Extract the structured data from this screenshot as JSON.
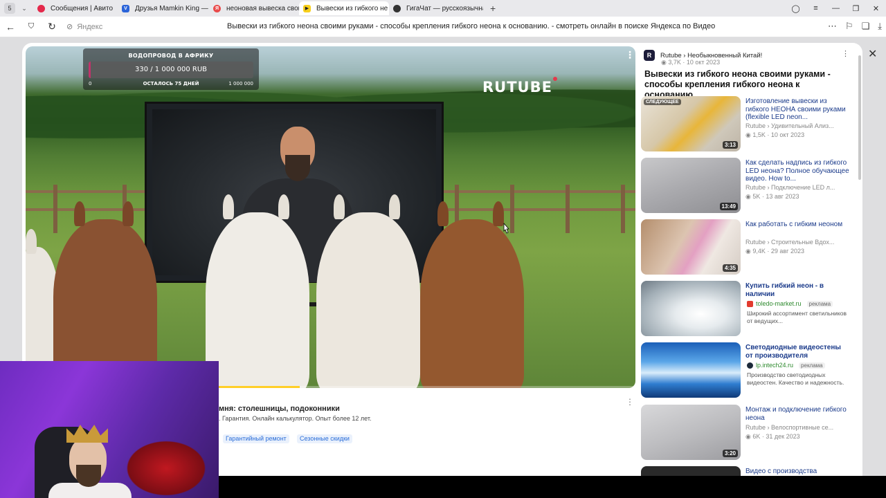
{
  "browser": {
    "tab_count": "5",
    "tabs": [
      {
        "label": "Сообщения | Авито",
        "color": "#e4294b",
        "glyph": "●"
      },
      {
        "label": "Друзья Mamkin King — 64",
        "color": "#2b64d9",
        "glyph": "V"
      },
      {
        "label": "неоновая вывеска свои",
        "color": "#e94b4b",
        "glyph": "Я"
      },
      {
        "label": "Вывески из гибкого не",
        "color": "#f7cf1b",
        "glyph": "▶"
      },
      {
        "label": "ГигаЧат — русскоязычна",
        "color": "#333333",
        "glyph": "◉"
      }
    ],
    "address_site": "Яндекс",
    "page_title": "Вывески из гибкого неона своими руками - способы крепления гибкого неона к основанию. - смотреть онлайн в поиске Яндекса по Видео"
  },
  "player": {
    "donation_title": "ВОДОПРОВОД В АФРИКУ",
    "donation_amount": "330 / 1 000 000 RUB",
    "donation_min": "0",
    "donation_left": "ОСТАЛОСЬ 75 ДНЕЙ",
    "donation_max": "1 000 000",
    "donation_progress": 0.00033,
    "brand": "RUTUBE",
    "playback_progress": 0.45
  },
  "ad": {
    "title": "мня: столешницы, подоконники",
    "desc": ". Гарантия. Онлайн калькулятор. Опыт более 12 лет.",
    "chips": [
      "Гарантийный ремонт",
      "Сезонные скидки"
    ]
  },
  "sidebar": {
    "channel": "Rutube › Необыкновенный Китай!",
    "meta": "3,7K · 10 окт 2023",
    "title": "Вывески из гибкого неона своими руками - способы крепления гибкого неона к основанию.",
    "items": [
      {
        "title": "Изготовление вывески из гибкого НЕОНА своими руками (flexible LED neon...",
        "channel": "Rutube › Удивительный Ализ...",
        "meta": "1,5K · 10 окт 2023",
        "duration": "3:13",
        "badge": "СЛЕДУЮЩЕЕ"
      },
      {
        "title": "Как сделать надпись из гибкого LED неона? Полное обучающее видео. How to...",
        "channel": "Rutube › Подключение LED л...",
        "meta": "5K · 13 авг 2023",
        "duration": "13:49"
      },
      {
        "title": "Как работать с гибким неоном",
        "channel": "Rutube › Строительные Вдох...",
        "meta": "9,4K · 29 авг 2023",
        "duration": "4:35"
      },
      {
        "title": "Купить гибкий неон - в наличии",
        "site": "toledo-market.ru",
        "ad_label": "реклама",
        "desc": "Широкий ассортимент светильников от ведущих..."
      },
      {
        "title": "Светодиодные видеостены от производителя",
        "site": "lp.intech24.ru",
        "ad_label": "реклама",
        "desc": "Производство светодиодных видеостен. Качество и надежность."
      },
      {
        "title": "Монтаж и подключение гибкого неона",
        "channel": "Rutube › Велоспортивные се...",
        "meta": "6K · 31 дек 2023",
        "duration": "3:20"
      },
      {
        "title": "Видео с производства"
      }
    ]
  }
}
